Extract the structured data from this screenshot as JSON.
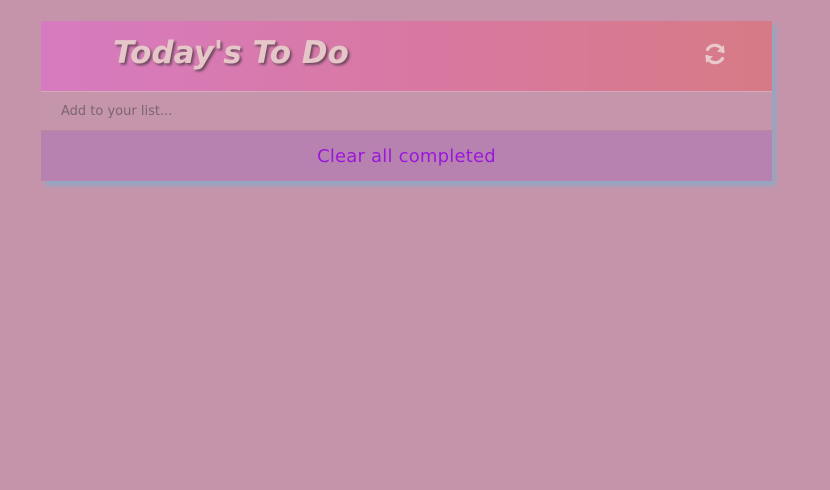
{
  "header": {
    "title": "Today's To Do",
    "refresh_icon": "refresh-icon"
  },
  "add": {
    "placeholder": "Add to your list..."
  },
  "footer": {
    "clear_label": "Clear all completed"
  },
  "colors": {
    "page_background": "#c594aa",
    "header_gradient_start": "#d77bc0",
    "header_gradient_end": "#d77a86",
    "title_text": "#e6c6c8",
    "footer_background": "#b882b0",
    "clear_text": "#9a18d8"
  }
}
